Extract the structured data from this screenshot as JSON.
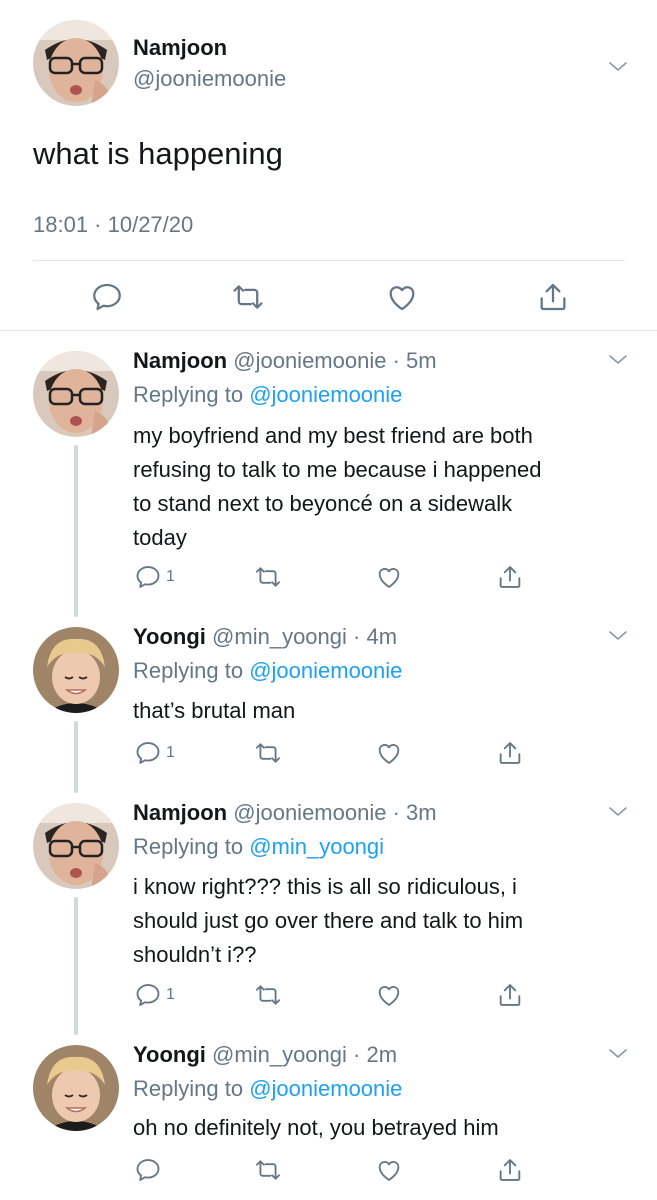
{
  "main_tweet": {
    "name": "Namjoon",
    "handle": "@jooniemoonie",
    "text": "what is happening",
    "timestamp": "18:01 · 10/27/20",
    "avatar_icon": "avatar-namjoon",
    "actions": [
      "reply-icon",
      "retweet-icon",
      "like-icon",
      "share-icon"
    ]
  },
  "replies": [
    {
      "name": "Namjoon",
      "handle": "@jooniemoonie",
      "time": "· 5m",
      "replying_prefix": "Replying to ",
      "replying_to": "@jooniemoonie",
      "text_lines": [
        "my boyfriend and my best friend are both",
        "refusing to talk to me because i happened",
        "to stand next to beyoncé on a sidewalk",
        "today"
      ],
      "reply_count": "1"
    },
    {
      "name": "Yoongi",
      "handle": "@min_yoongi",
      "time": "· 4m",
      "replying_prefix": "Replying to ",
      "replying_to": "@jooniemoonie",
      "text_lines": [
        "that’s brutal man"
      ],
      "reply_count": "1"
    },
    {
      "name": "Namjoon",
      "handle": "@jooniemoonie",
      "time": "· 3m",
      "replying_prefix": "Replying to ",
      "replying_to": "@min_yoongi",
      "text_lines": [
        "i know right??? this is all so ridiculous, i",
        "should just go over there and talk to him",
        "shouldn’t i??"
      ],
      "reply_count": "1"
    },
    {
      "name": "Yoongi",
      "handle": "@min_yoongi",
      "time": "· 2m",
      "replying_prefix": "Replying to ",
      "replying_to": "@jooniemoonie",
      "text_lines": [
        "oh no definitely not, you betrayed him"
      ],
      "reply_count": ""
    }
  ],
  "colors": {
    "accent": "#1da1f2",
    "secondary_text": "#657786",
    "divider": "#e1e8ed",
    "thread_line": "#cfd9de"
  }
}
